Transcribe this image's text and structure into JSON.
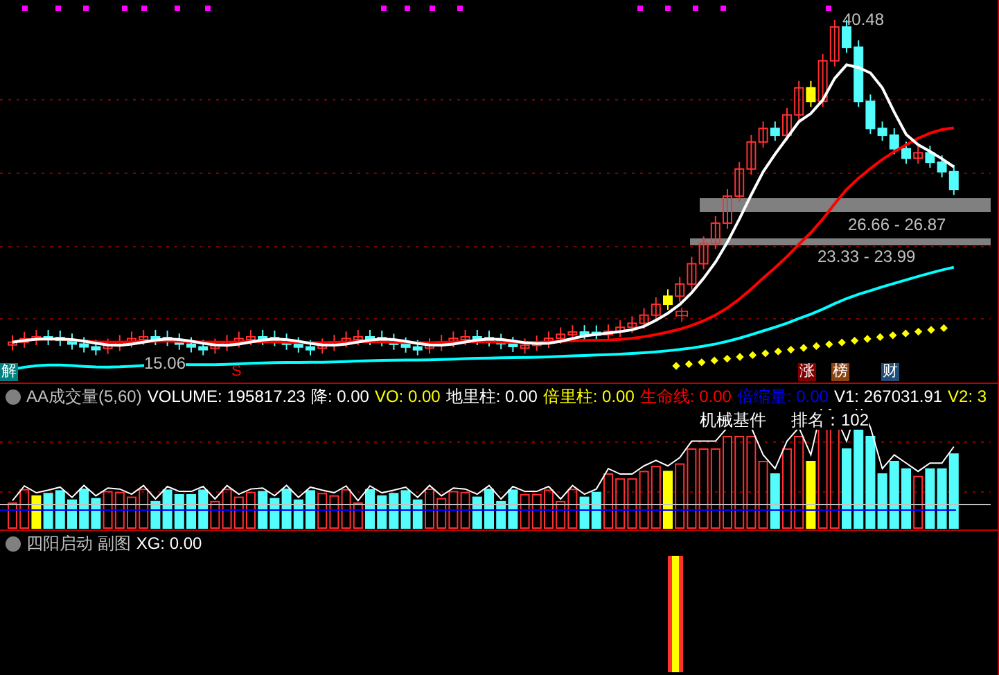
{
  "main_chart": {
    "high_label": "40.48",
    "low_label": "15.06",
    "candle_tag": "中",
    "zones": [
      {
        "text": "26.66 - 26.87"
      },
      {
        "text": "23.33 - 23.99"
      }
    ],
    "markers": [
      {
        "text": "解",
        "color": "#008080"
      },
      {
        "text": "S",
        "color": "#ff0000"
      },
      {
        "text": "涨",
        "color": "#800000"
      },
      {
        "text": "榜",
        "color": "#8b4513"
      },
      {
        "text": "财",
        "color": "#1f4e79"
      }
    ]
  },
  "volume_panel": {
    "title": "AA成交量(5,60)",
    "readings": [
      {
        "text": "VOLUME: 195817.23",
        "color": "#ffffff"
      },
      {
        "text": "降: 0.00",
        "color": "#ffffff"
      },
      {
        "text": "VO: 0.00",
        "color": "#ffff00"
      },
      {
        "text": "地里柱: 0.00",
        "color": "#ffffff"
      },
      {
        "text": "倍里柱: 0.00",
        "color": "#ffff00"
      },
      {
        "text": "生命线: 0.00",
        "color": "#ff0000"
      },
      {
        "text": "倍缩量: 0.00",
        "color": "#0000ff"
      },
      {
        "text": "V1: 267031.91",
        "color": "#ffffff"
      },
      {
        "text": "V2: 3",
        "color": "#ffff00"
      }
    ],
    "sector": "机械基件",
    "rank": "排名：102"
  },
  "sub_panel": {
    "title": "四阳启动 副图",
    "readings": [
      {
        "text": "XG: 0.00",
        "color": "#ffffff"
      }
    ]
  }
}
